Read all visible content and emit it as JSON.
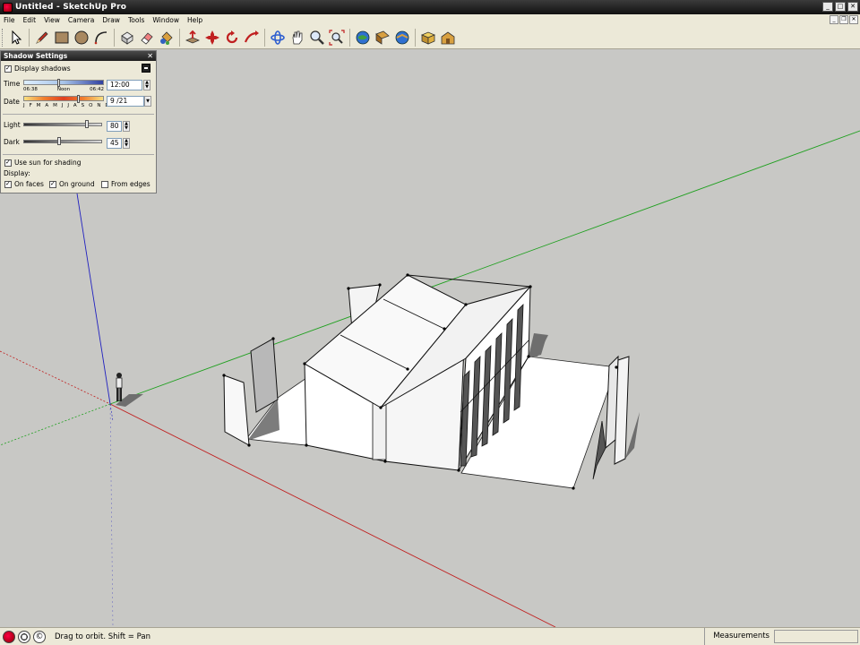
{
  "window": {
    "title": "Untitled - SketchUp Pro"
  },
  "menu": [
    "File",
    "Edit",
    "View",
    "Camera",
    "Draw",
    "Tools",
    "Window",
    "Help"
  ],
  "toolbar": {
    "tools": [
      "select-icon",
      "pencil-icon",
      "rectangle-icon",
      "circle-icon",
      "arc-icon",
      "make-component-icon",
      "eraser-icon",
      "paint-bucket-icon",
      "push-pull-icon",
      "move-icon",
      "rotate-icon",
      "follow-me-icon",
      "orbit-icon",
      "pan-icon",
      "zoom-icon",
      "zoom-extents-icon",
      "get-models-icon",
      "share-model-icon",
      "google-earth-icon",
      "components-icon",
      "warehouse-icon"
    ]
  },
  "shadow_panel": {
    "title": "Shadow Settings",
    "display_shadows_label": "Display shadows",
    "display_shadows": true,
    "time_label": "Time",
    "time_start": "06:38",
    "time_mid": "Noon",
    "time_end": "06:42",
    "time_value": "12:00",
    "date_label": "Date",
    "months": "J F M A M J J A S O N D",
    "date_value": "9 /21",
    "light_label": "Light",
    "light_value": "80",
    "dark_label": "Dark",
    "dark_value": "45",
    "use_sun_label": "Use sun for shading",
    "use_sun": true,
    "display_label": "Display:",
    "on_faces_label": "On faces",
    "on_faces": true,
    "on_ground_label": "On ground",
    "on_ground": true,
    "from_edges_label": "From edges",
    "from_edges": false
  },
  "statusbar": {
    "hint": "Drag to orbit.  Shift = Pan",
    "measurements_label": "Measurements",
    "measurements_value": ""
  },
  "colors": {
    "viewport_bg": "#c8c8c5",
    "axis_red": "#c02020",
    "axis_green": "#20a020",
    "axis_blue": "#2020c0",
    "shadow": "#6e6e6e"
  }
}
